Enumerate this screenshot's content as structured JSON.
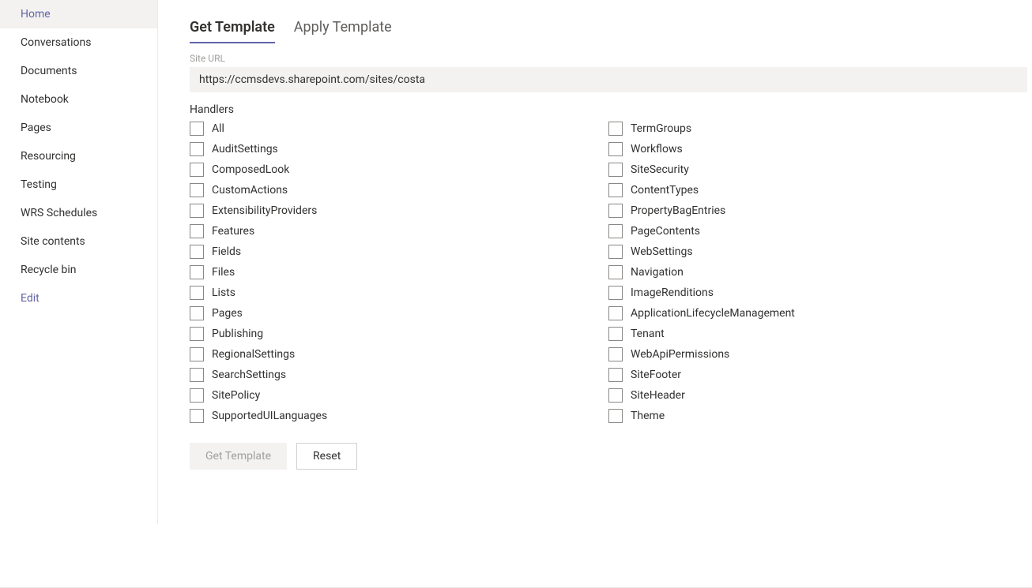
{
  "sidebar": {
    "items": [
      {
        "label": "Home",
        "active": true
      },
      {
        "label": "Conversations"
      },
      {
        "label": "Documents"
      },
      {
        "label": "Notebook"
      },
      {
        "label": "Pages"
      },
      {
        "label": "Resourcing"
      },
      {
        "label": "Testing"
      },
      {
        "label": "WRS Schedules"
      },
      {
        "label": "Site contents"
      },
      {
        "label": "Recycle bin"
      },
      {
        "label": "Edit",
        "edit": true
      }
    ]
  },
  "tabs": [
    {
      "label": "Get Template",
      "active": true
    },
    {
      "label": "Apply Template"
    }
  ],
  "siteUrl": {
    "label": "Site URL",
    "value": "https://ccmsdevs.sharepoint.com/sites/costa"
  },
  "handlers": {
    "label": "Handlers",
    "col1": [
      "All",
      "AuditSettings",
      "ComposedLook",
      "CustomActions",
      "ExtensibilityProviders",
      "Features",
      "Fields",
      "Files",
      "Lists",
      "Pages",
      "Publishing",
      "RegionalSettings",
      "SearchSettings",
      "SitePolicy",
      "SupportedUILanguages"
    ],
    "col2": [
      "TermGroups",
      "Workflows",
      "SiteSecurity",
      "ContentTypes",
      "PropertyBagEntries",
      "PageContents",
      "WebSettings",
      "Navigation",
      "ImageRenditions",
      "ApplicationLifecycleManagement",
      "Tenant",
      "WebApiPermissions",
      "SiteFooter",
      "SiteHeader",
      "Theme"
    ]
  },
  "buttons": {
    "getTemplate": "Get Template",
    "reset": "Reset"
  }
}
